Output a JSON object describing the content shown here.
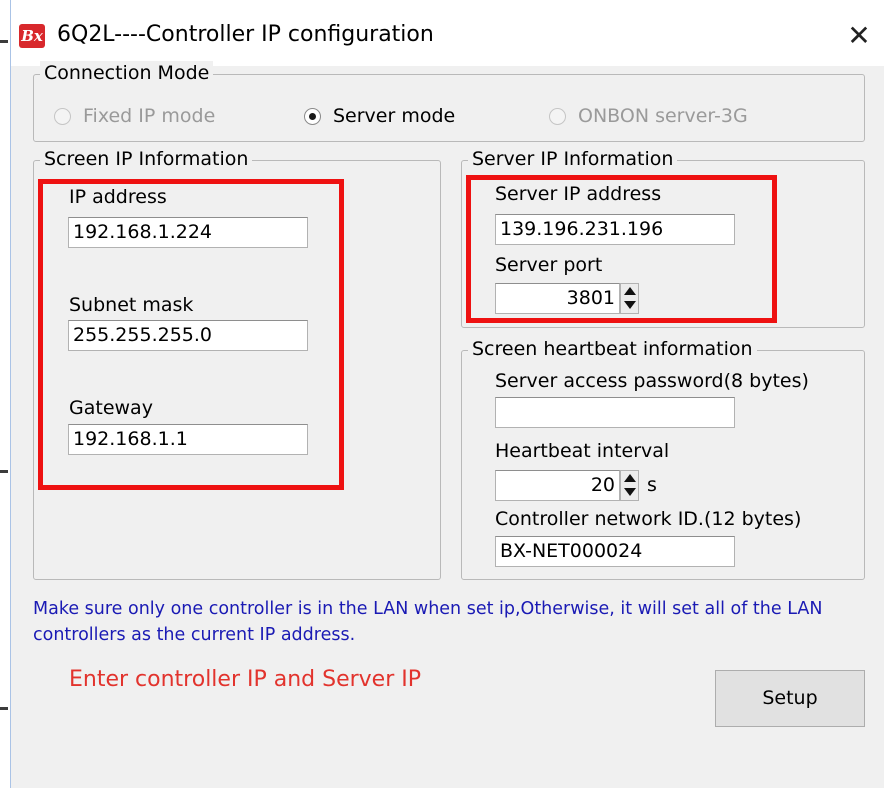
{
  "window": {
    "title": "6Q2L----Controller IP configuration",
    "logo_text": "Bx",
    "close_glyph": "✕"
  },
  "connection_mode": {
    "legend": "Connection Mode",
    "options": [
      {
        "label": "Fixed IP mode",
        "selected": false,
        "enabled": false
      },
      {
        "label": "Server mode",
        "selected": true,
        "enabled": true
      },
      {
        "label": "ONBON server-3G",
        "selected": false,
        "enabled": false
      }
    ]
  },
  "screen_ip": {
    "legend": "Screen IP Information",
    "ip_label": "IP address",
    "ip_value": "192.168.1.224",
    "subnet_label": "Subnet mask",
    "subnet_value": "255.255.255.0",
    "gateway_label": "Gateway",
    "gateway_value": "192.168.1.1"
  },
  "server_ip": {
    "legend": "Server IP Information",
    "address_label": "Server IP address",
    "address_value": "139.196.231.196",
    "port_label": "Server port",
    "port_value": "3801"
  },
  "heartbeat": {
    "legend": "Screen heartbeat information",
    "password_label": "Server access password(8 bytes)",
    "password_value": "",
    "interval_label": "Heartbeat interval",
    "interval_value": "20",
    "interval_unit": "s",
    "network_id_label": "Controller network ID.(12 bytes)",
    "network_id_value": "BX-NET000024"
  },
  "note": "Make sure only one controller is in the LAN when set ip,Otherwise, it will set all of the LAN controllers as the current IP address.",
  "annotation": "Enter controller IP and Server IP",
  "setup_button": "Setup",
  "colors": {
    "highlight": "#ee1111",
    "note_text": "#1a1ab4",
    "annotation_text": "#e2332d",
    "window_bg": "#f0f0f0"
  }
}
